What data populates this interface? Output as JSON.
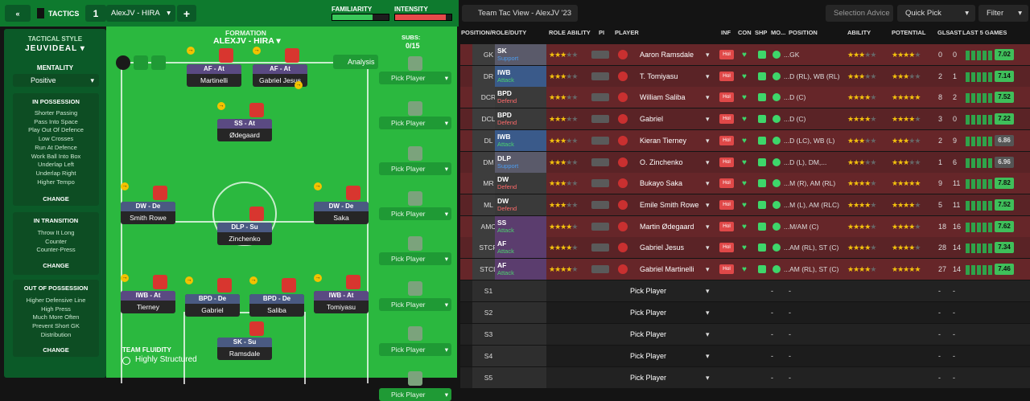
{
  "topbar": {
    "tactics_label": "TACTICS",
    "slot": "1",
    "tactic_name": "AlexJV - HIRA",
    "familiarity_label": "FAMILIARITY",
    "intensity_label": "INTENSITY",
    "familiarity": 0.72,
    "intensity": 0.9
  },
  "left": {
    "style_title": "TACTICAL STYLE",
    "style": "JEUVIDEAL",
    "mentality_title": "MENTALITY",
    "mentality": "Positive",
    "possession_title": "IN POSSESSION",
    "possession": [
      "Shorter Passing",
      "Pass Into Space",
      "Play Out Of Defence",
      "Low Crosses",
      "Run At Defence",
      "Work Ball Into Box",
      "Underlap Left",
      "Underlap Right",
      "Higher Tempo"
    ],
    "transition_title": "IN TRANSITION",
    "transition": [
      "Throw It Long",
      "Counter",
      "Counter-Press"
    ],
    "oop_title": "OUT OF POSSESSION",
    "oop": [
      "Higher Defensive Line",
      "High Press",
      "Much More Often",
      "Prevent Short GK",
      "Distribution"
    ],
    "change": "CHANGE"
  },
  "pitch": {
    "formation_title": "FORMATION",
    "formation_name": "ALEXJV - HIRA",
    "subs_label": "SUBS:",
    "subs_count": "0/15",
    "analysis": "Analysis",
    "fluidity_title": "TEAM FLUIDITY",
    "fluidity": "Highly Structured",
    "players": [
      {
        "role": "AF - At",
        "name": "Martinelli"
      },
      {
        "role": "AF - At",
        "name": "Gabriel Jesus"
      },
      {
        "role": "SS - At",
        "name": "Ødegaard"
      },
      {
        "role": "DW - De",
        "name": "Smith Rowe"
      },
      {
        "role": "DW - De",
        "name": "Saka"
      },
      {
        "role": "DLP - Su",
        "name": "Zinchenko"
      },
      {
        "role": "IWB - At",
        "name": "Tierney"
      },
      {
        "role": "BPD - De",
        "name": "Gabriel"
      },
      {
        "role": "BPD - De",
        "name": "Saliba"
      },
      {
        "role": "IWB - At",
        "name": "Tomiyasu"
      },
      {
        "role": "SK - Su",
        "name": "Ramsdale"
      }
    ],
    "pick_player": "Pick Player"
  },
  "right": {
    "view": "Team Tac View - AlexJV '23",
    "selection_advice": "Selection Advice",
    "quick_pick": "Quick Pick",
    "filter": "Filter",
    "headers": {
      "pos": "POSITION/ROLE/DUTY",
      "role_ability": "ROLE ABILITY",
      "pi": "PI",
      "player": "PLAYER",
      "inf": "INF",
      "con": "CON",
      "shp": "SHP",
      "mo": "MO...",
      "position": "POSITION",
      "ability": "ABILITY",
      "potential": "POTENTIAL",
      "gls": "GLS",
      "ast": "AST",
      "last5": "LAST 5 GAMES"
    },
    "rows": [
      {
        "pos": "GK",
        "role": "SK",
        "duty": "Support",
        "name": "Aaron Ramsdale",
        "position": "...GK",
        "gls": "0",
        "ast": "0",
        "rating": "7.02",
        "ra": 3,
        "ab": 3,
        "pot": 4
      },
      {
        "pos": "DR",
        "role": "IWB",
        "duty": "Attack",
        "name": "T. Tomiyasu",
        "position": "...D (RL), WB (RL)",
        "gls": "2",
        "ast": "1",
        "rating": "7.14",
        "ra": 2.5,
        "ab": 3,
        "pot": 3
      },
      {
        "pos": "DCR",
        "role": "BPD",
        "duty": "Defend",
        "name": "William Saliba",
        "position": "...D (C)",
        "gls": "8",
        "ast": "2",
        "rating": "7.52",
        "ra": 3,
        "ab": 3.5,
        "pot": 4.5
      },
      {
        "pos": "DCL",
        "role": "BPD",
        "duty": "Defend",
        "name": "Gabriel",
        "position": "...D (C)",
        "gls": "3",
        "ast": "0",
        "rating": "7.22",
        "ra": 3,
        "ab": 3.5,
        "pot": 3.5
      },
      {
        "pos": "DL",
        "role": "IWB",
        "duty": "Attack",
        "name": "Kieran Tierney",
        "position": "...D (LC), WB (L)",
        "gls": "2",
        "ast": "9",
        "rating": "6.86",
        "ra": 2.5,
        "ab": 3,
        "pot": 3
      },
      {
        "pos": "DM",
        "role": "DLP",
        "duty": "Support",
        "name": "O. Zinchenko",
        "position": "...D (L), DM,...",
        "gls": "1",
        "ast": "6",
        "rating": "6.96",
        "ra": 2.5,
        "ab": 3,
        "pot": 3
      },
      {
        "pos": "MR",
        "role": "DW",
        "duty": "Defend",
        "name": "Bukayo Saka",
        "position": "...M (R), AM (RL)",
        "gls": "9",
        "ast": "11",
        "rating": "7.82",
        "ra": 3,
        "ab": 4,
        "pot": 5
      },
      {
        "pos": "ML",
        "role": "DW",
        "duty": "Defend",
        "name": "Emile Smith Rowe",
        "position": "...M (L), AM (RLC)",
        "gls": "5",
        "ast": "11",
        "rating": "7.52",
        "ra": 2.5,
        "ab": 3.5,
        "pot": 4
      },
      {
        "pos": "AMC",
        "role": "SS",
        "duty": "Attack",
        "name": "Martin Ødegaard",
        "position": "...M/AM (C)",
        "gls": "18",
        "ast": "16",
        "rating": "7.62",
        "ra": 4,
        "ab": 4,
        "pot": 4
      },
      {
        "pos": "STCR",
        "role": "AF",
        "duty": "Attack",
        "name": "Gabriel Jesus",
        "position": "...AM (RL), ST (C)",
        "gls": "28",
        "ast": "14",
        "rating": "7.34",
        "ra": 4,
        "ab": 4,
        "pot": 4
      },
      {
        "pos": "STCL",
        "role": "AF",
        "duty": "Attack",
        "name": "Gabriel Martinelli",
        "position": "...AM (RL), ST (C)",
        "gls": "27",
        "ast": "14",
        "rating": "7.46",
        "ra": 4,
        "ab": 4,
        "pot": 4.5
      }
    ],
    "subs": [
      "S1",
      "S2",
      "S3",
      "S4",
      "S5"
    ],
    "dash": "-"
  }
}
